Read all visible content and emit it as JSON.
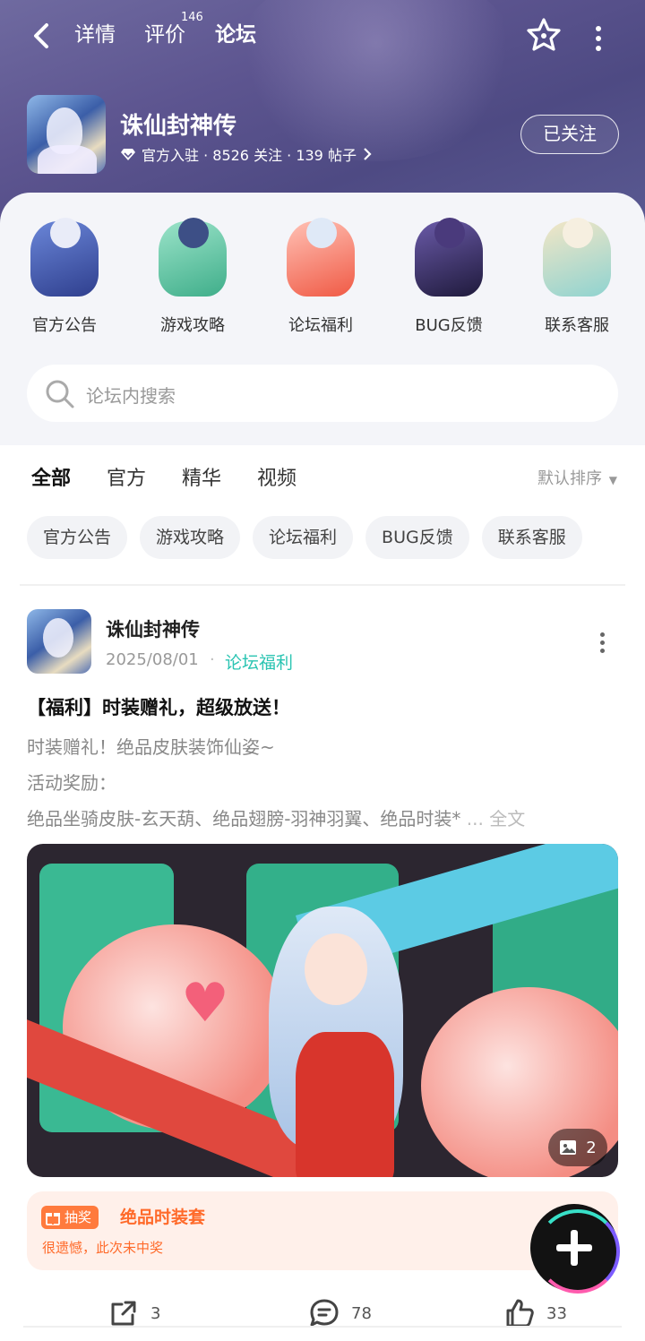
{
  "nav": {
    "tabs": [
      "详情",
      "评价",
      "论坛"
    ],
    "review_count": "146",
    "active_tab": "论坛"
  },
  "game": {
    "name": "诛仙封神传",
    "meta": "官方入驻 · 8526 关注 · 139 帖子",
    "follow_label": "已关注"
  },
  "categories": [
    {
      "label": "官方公告",
      "icon": "announcement-art"
    },
    {
      "label": "游戏攻略",
      "icon": "guide-art"
    },
    {
      "label": "论坛福利",
      "icon": "welfare-art"
    },
    {
      "label": "BUG反馈",
      "icon": "bug-report-art"
    },
    {
      "label": "联系客服",
      "icon": "customer-service-art"
    }
  ],
  "search": {
    "placeholder": "论坛内搜索"
  },
  "filter_tabs": [
    "全部",
    "官方",
    "精华",
    "视频"
  ],
  "sort_label": "默认排序",
  "chips": [
    "官方公告",
    "游戏攻略",
    "论坛福利",
    "BUG反馈",
    "联系客服"
  ],
  "post": {
    "author": "诛仙封神传",
    "date": "2025/08/01",
    "category": "论坛福利",
    "title": "【福利】时装赠礼，超级放送！",
    "lines": [
      "时装赠礼！绝品皮肤装饰仙姿~",
      "活动奖励：",
      "绝品坐骑皮肤-玄天葫、绝品翅膀-羽神羽翼、绝品时装*"
    ],
    "ellipsis": "...",
    "full_text": "全文",
    "image_count": "2",
    "lottery": {
      "tag": "抽奖",
      "prize": "绝品时装套",
      "result": "很遗憾，此次未中奖"
    },
    "shares": "3",
    "comments": "78",
    "likes": "33"
  },
  "colors": {
    "accent": "#2fd3c1",
    "header": "#5d5590",
    "lottery": "#ff6a2a"
  }
}
